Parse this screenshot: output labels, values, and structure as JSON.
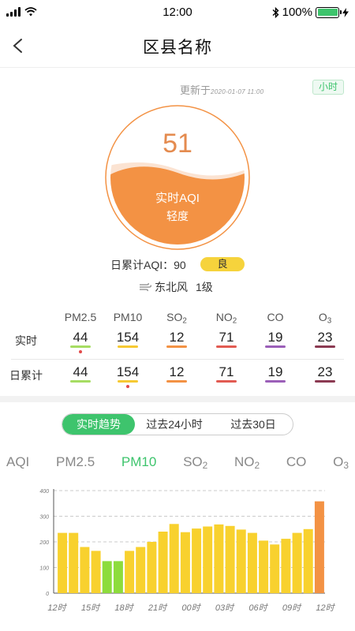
{
  "status_bar": {
    "time": "12:00",
    "battery": "100%"
  },
  "nav": {
    "title": "区县名称"
  },
  "summary": {
    "update_label": "更新于",
    "update_time": "2020-01-07 11:00",
    "hour_badge": "小时",
    "aqi_value": "51",
    "aqi_label": "实时AQI",
    "aqi_level": "轻度",
    "daily_text": "日累计AQI：90",
    "daily_level": "良",
    "daily_level_color": "#f6d33c",
    "wind_dir": "东北风",
    "wind_level": "1级"
  },
  "table": {
    "columns": [
      {
        "base": "PM2.5",
        "sub": ""
      },
      {
        "base": "PM10",
        "sub": ""
      },
      {
        "base": "SO",
        "sub": "2"
      },
      {
        "base": "NO",
        "sub": "2"
      },
      {
        "base": "CO",
        "sub": ""
      },
      {
        "base": "O",
        "sub": "3"
      }
    ],
    "line_colors": [
      "#a6dd63",
      "#f6c932",
      "#f39244",
      "#e25b52",
      "#9b5fb8",
      "#8b3a52"
    ],
    "rows": [
      {
        "label": "实时",
        "values": [
          "44",
          "154",
          "12",
          "71",
          "19",
          "23"
        ],
        "dot_index": 0
      },
      {
        "label": "日累计",
        "values": [
          "44",
          "154",
          "12",
          "71",
          "19",
          "23"
        ],
        "dot_index": 1
      }
    ]
  },
  "trend_tabs": [
    "实时趋势",
    "过去24小时",
    "过去30日"
  ],
  "trend_active": 0,
  "pollutant_tabs": [
    {
      "base": "AQI",
      "sub": ""
    },
    {
      "base": "PM2.5",
      "sub": ""
    },
    {
      "base": "PM10",
      "sub": ""
    },
    {
      "base": "SO",
      "sub": "2"
    },
    {
      "base": "NO",
      "sub": "2"
    },
    {
      "base": "CO",
      "sub": ""
    },
    {
      "base": "O",
      "sub": "3"
    }
  ],
  "pollutant_active": 2,
  "colors": {
    "accent": "#3ec46d",
    "gauge": "#f39244",
    "yellow": "#f8d12e",
    "green": "#8ddc3c",
    "orange": "#f39244"
  },
  "chart_data": {
    "type": "bar",
    "ylim": [
      0,
      400
    ],
    "yticks": [
      "0",
      "100",
      "200",
      "300",
      "400"
    ],
    "xticks": [
      "12时",
      "15时",
      "18时",
      "21时",
      "00时",
      "03时",
      "06时",
      "09时",
      "12时"
    ],
    "values": [
      235,
      235,
      180,
      165,
      125,
      125,
      165,
      180,
      200,
      240,
      270,
      238,
      252,
      260,
      268,
      262,
      248,
      235,
      205,
      190,
      212,
      235,
      250,
      358
    ],
    "bar_levels": [
      "yellow",
      "yellow",
      "yellow",
      "yellow",
      "green",
      "green",
      "yellow",
      "yellow",
      "yellow",
      "yellow",
      "yellow",
      "yellow",
      "yellow",
      "yellow",
      "yellow",
      "yellow",
      "yellow",
      "yellow",
      "yellow",
      "yellow",
      "yellow",
      "yellow",
      "yellow",
      "orange"
    ]
  }
}
